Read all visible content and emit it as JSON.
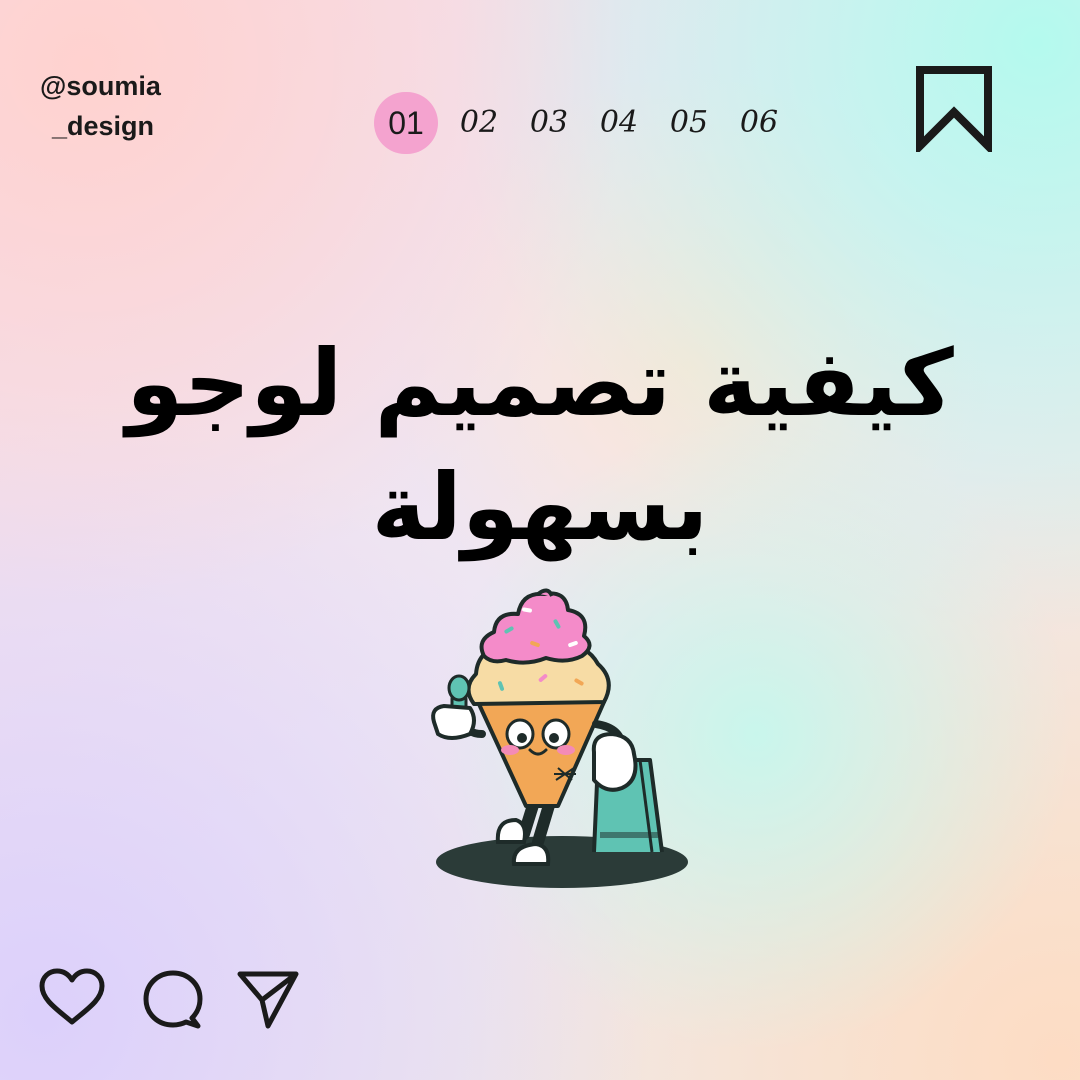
{
  "header": {
    "handle_line1": "@soumia",
    "handle_line2": "_design",
    "pages": [
      "01",
      "02",
      "03",
      "04",
      "05",
      "06"
    ],
    "active_page": "01"
  },
  "title": {
    "line1": "كيفية تصميم لوجو",
    "line2": "بسهولة"
  },
  "icons": {
    "bookmark": "bookmark-icon",
    "like": "heart-icon",
    "comment": "comment-icon",
    "share": "send-icon"
  },
  "colors": {
    "active_page_bg": "#f4a3cf",
    "text": "#000000"
  }
}
